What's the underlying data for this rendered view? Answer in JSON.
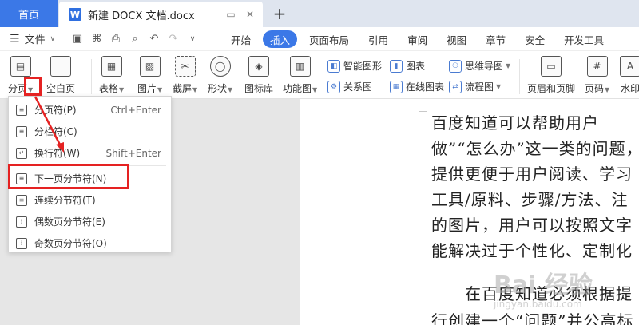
{
  "tabs": {
    "home": "首页",
    "doc_title": "新建 DOCX 文档.docx",
    "doc_icon": "W"
  },
  "menu": {
    "file": "文件",
    "tabs": [
      "开始",
      "插入",
      "页面布局",
      "引用",
      "审阅",
      "视图",
      "章节",
      "安全",
      "开发工具"
    ],
    "active_tab": "插入"
  },
  "ribbon": {
    "break": "分页",
    "blank_page": "空白页",
    "table": "表格",
    "picture": "图片",
    "screenshot": "截屏",
    "shape": "形状",
    "icon_lib": "图标库",
    "func_chart": "功能图",
    "smart_graphic": "智能图形",
    "chart": "图表",
    "mind_map": "思维导图",
    "relation": "关系图",
    "online_chart": "在线图表",
    "flowchart": "流程图",
    "header_footer": "页眉和页脚",
    "page_number": "页码",
    "watermark": "水印"
  },
  "dropdown": {
    "items": [
      {
        "label": "分页符(P)",
        "shortcut": "Ctrl+Enter"
      },
      {
        "label": "分栏符(C)",
        "shortcut": ""
      },
      {
        "label": "换行符(W)",
        "shortcut": "Shift+Enter"
      },
      {
        "label": "下一页分节符(N)",
        "shortcut": ""
      },
      {
        "label": "连续分节符(T)",
        "shortcut": ""
      },
      {
        "label": "偶数页分节符(E)",
        "shortcut": ""
      },
      {
        "label": "奇数页分节符(O)",
        "shortcut": ""
      }
    ]
  },
  "document": {
    "lines": [
      "百度知道可以帮助用户",
      "做”“怎么办”这一类的问题，",
      "提供更便于用户阅读、学习",
      "工具/原料、步骤/方法、注",
      "的图片，用户可以按照文字",
      "能解决过于个性化、定制化",
      "在百度知道必须根据提",
      "行创建一个“问题”并公高标"
    ]
  },
  "watermark": {
    "text": "Bai 经验",
    "sub": "jingyan.baidu.com"
  },
  "colors": {
    "accent": "#3b78e7",
    "highlight": "#e52222"
  }
}
